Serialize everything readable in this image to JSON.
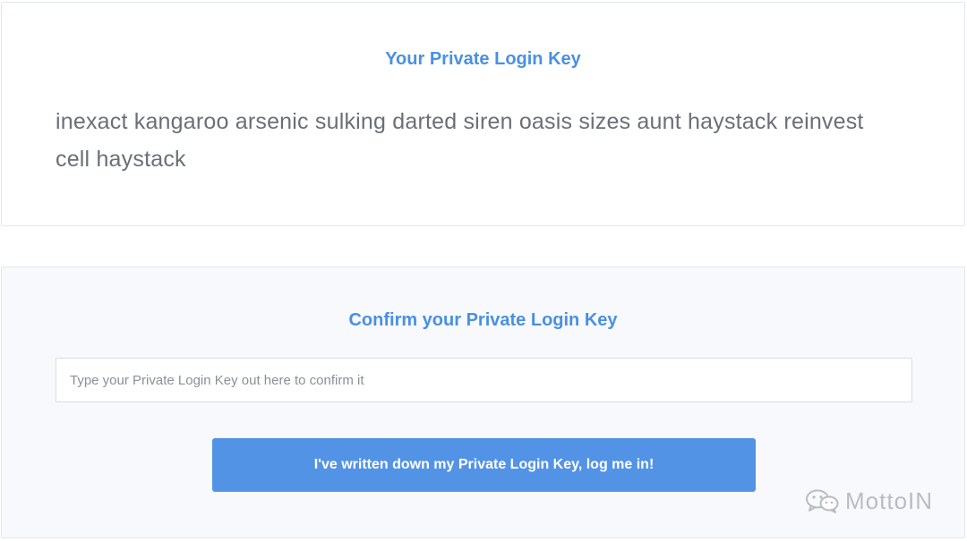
{
  "private_key_card": {
    "title": "Your Private Login Key",
    "phrase": "inexact kangaroo arsenic sulking darted siren oasis sizes aunt haystack reinvest cell haystack"
  },
  "confirm_card": {
    "title": "Confirm your Private Login Key",
    "input": {
      "placeholder": "Type your Private Login Key out here to confirm it",
      "value": ""
    },
    "button_label": "I've written down my Private Login Key, log me in!"
  },
  "watermark": {
    "icon": "wechat-icon",
    "text": "MottoIN"
  },
  "colors": {
    "accent": "#4a90e2",
    "button": "#5393e5",
    "body_text": "#6b6f78",
    "panel_bg": "#f7f9fc"
  }
}
